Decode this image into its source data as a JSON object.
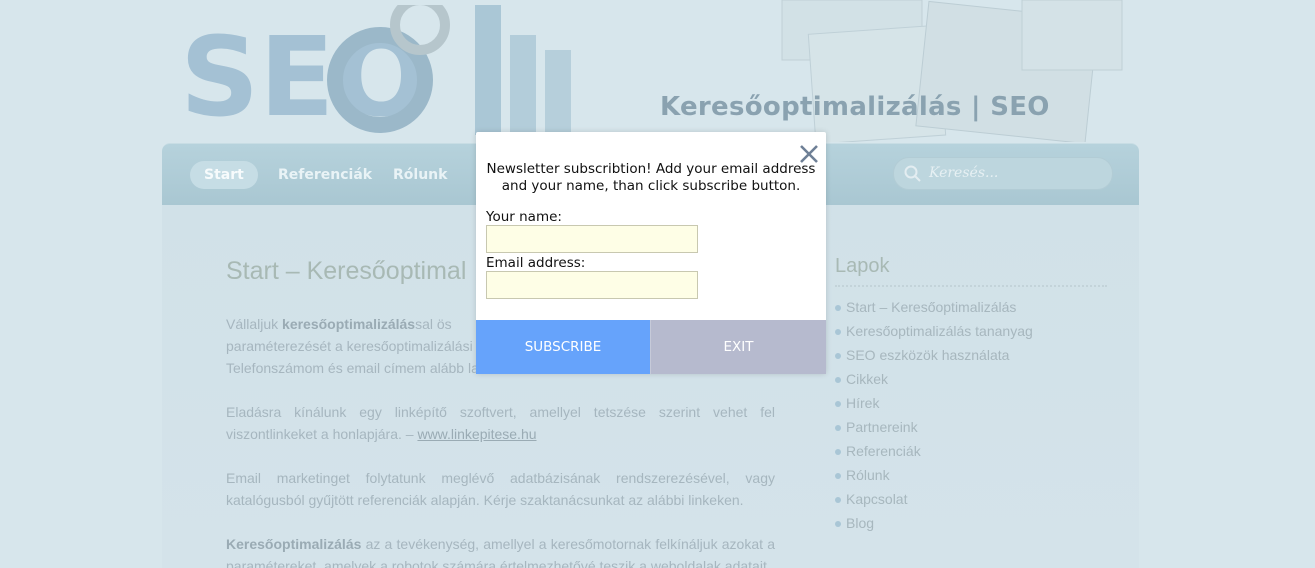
{
  "header": {
    "site_title": "Keresőoptimalizálás | SEO",
    "logo_text": "SEO"
  },
  "nav": {
    "items": [
      {
        "label": "Start",
        "active": true
      },
      {
        "label": "Referenciák",
        "active": false
      },
      {
        "label": "Rólunk",
        "active": false
      }
    ],
    "search_placeholder": "Keresés..."
  },
  "main": {
    "title": "Start – Keresőoptimal",
    "p1": {
      "a": "Vállaljuk ",
      "b": "keresőoptimalizálás",
      "c": "sal ös",
      "line2": "paraméterezését a keresőoptimalizálási",
      "line3": "Telefonszámom és email címem alább la"
    },
    "p2": {
      "text": "Eladásra kínálunk egy linképítő szoftvert, amellyel tetszése szerint vehet fel viszontlinkeket a honlapjára. – ",
      "link": "www.linkepitese.hu"
    },
    "p3": "Email marketinget folytatunk meglévő adatbázisának rendszerezésével, vagy katalógusból gyűjtött referenciák alapján. Kérje szaktanácsunkat az alábbi linkeken.",
    "p4": {
      "b": "Keresőoptimalizálás",
      "text": " az a tevékenység, amellyel a keresőmotornak felkínáljuk azokat a paramétereket, amelyek a robotok számára értelmezhetővé teszik a weboldalak adatait."
    }
  },
  "sidebar": {
    "title": "Lapok",
    "items": [
      "Start – Keresőoptimalizálás",
      "Keresőoptimalizálás tananyag",
      "SEO eszközök használata",
      "Cikkek",
      "Hírek",
      "Partnereink",
      "Referenciák",
      "Rólunk",
      "Kapcsolat",
      "Blog"
    ]
  },
  "modal": {
    "message": "Newsletter subscribtion! Add your email address and your name, than click subscribe button.",
    "name_label": "Your name:",
    "name_value": "",
    "email_label": "Email address:",
    "email_value": "",
    "subscribe_label": "SUBSCRIBE",
    "exit_label": "EXIT"
  },
  "colors": {
    "subscribe_bg": "#66a3fb",
    "exit_bg": "#b6bace",
    "input_bg": "#fefee6"
  }
}
